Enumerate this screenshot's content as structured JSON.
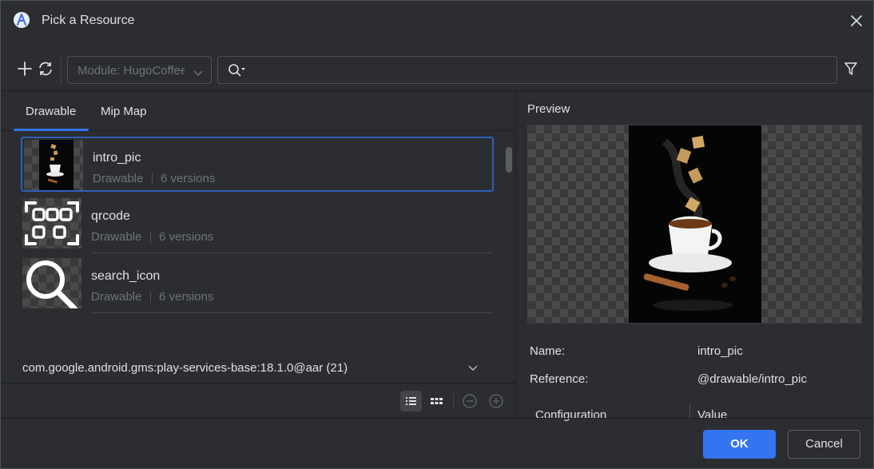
{
  "dialog": {
    "title": "Pick a Resource",
    "app_icon": "android-studio-icon",
    "close_icon": "close-icon"
  },
  "toolbar": {
    "add_icon": "plus-icon",
    "refresh_icon": "refresh-icon",
    "module_select": {
      "value": "Module: HugoCoffee",
      "icon": "chevron-down-icon"
    },
    "search": {
      "value": "",
      "icon": "search-icon"
    },
    "filter_icon": "filter-icon"
  },
  "tabs": [
    {
      "label": "Drawable",
      "active": true
    },
    {
      "label": "Mip Map",
      "active": false
    }
  ],
  "resources": [
    {
      "name": "intro_pic",
      "type": "Drawable",
      "versions": "6 versions",
      "selected": true,
      "thumb": "coffee-photo"
    },
    {
      "name": "qrcode",
      "type": "Drawable",
      "versions": "6 versions",
      "selected": false,
      "thumb": "qrcode-icon"
    },
    {
      "name": "search_icon",
      "type": "Drawable",
      "versions": "6 versions",
      "selected": false,
      "thumb": "search-icon"
    }
  ],
  "library_section": {
    "label": "com.google.android.gms:play-services-base:18.1.0@aar (21)",
    "icon": "chevron-down-icon"
  },
  "view_controls": {
    "list_view_icon": "list-view-icon",
    "grid_view_icon": "grid-view-icon",
    "zoom_out_icon": "zoom-out-icon",
    "zoom_in_icon": "zoom-in-icon"
  },
  "preview": {
    "label": "Preview",
    "name_label": "Name:",
    "name_value": "intro_pic",
    "reference_label": "Reference:",
    "reference_value": "@drawable/intro_pic",
    "configuration_header": "Configuration",
    "value_header": "Value"
  },
  "footer": {
    "ok_label": "OK",
    "cancel_label": "Cancel"
  },
  "colors": {
    "background": "#2b2d30",
    "accent": "#3574f0",
    "selection_border": "#2e5fb8",
    "muted_text": "#6f737a"
  }
}
